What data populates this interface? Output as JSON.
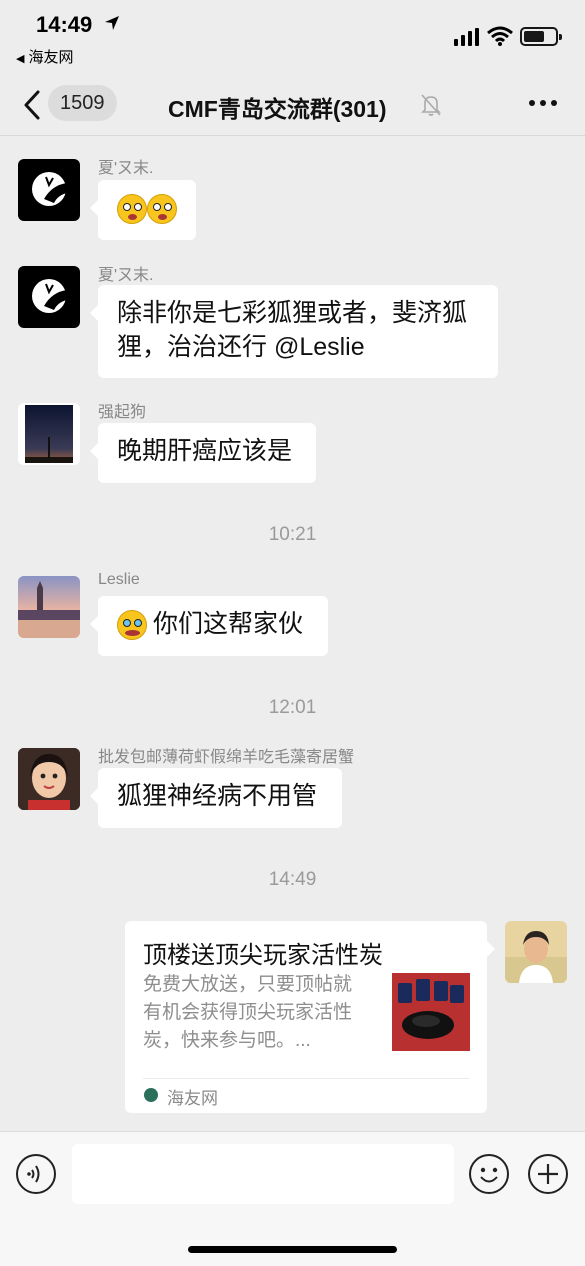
{
  "status_bar": {
    "time": "14:49",
    "back_app_label": "海友网",
    "back_app_glyph": "◀"
  },
  "nav": {
    "unread_count": "1509",
    "title": "CMF青岛交流群(301)"
  },
  "messages": [
    {
      "type": "text",
      "sender": "夏'ㄡ末.",
      "text": ""
    },
    {
      "type": "text",
      "sender": "夏'ㄡ末.",
      "text": "除非你是七彩狐狸或者，斐济狐狸，治治还行 @Leslie"
    },
    {
      "type": "text",
      "sender": "强起狗",
      "text": "晚期肝癌应该是"
    },
    {
      "type": "time",
      "text": "10:21"
    },
    {
      "type": "text",
      "sender": "Leslie",
      "text": "你们这帮家伙"
    },
    {
      "type": "time",
      "text": "12:01"
    },
    {
      "type": "text",
      "sender": "批发包邮薄荷虾假绵羊吃毛藻寄居蟹",
      "text": "狐狸神经病不用管"
    },
    {
      "type": "time",
      "text": "14:49"
    },
    {
      "type": "link_card",
      "card_title": "顶楼送顶尖玩家活性炭",
      "card_desc": "免费大放送，只要顶帖就有机会获得顶尖玩家活性炭，快来参与吧。...",
      "source": "海友网"
    }
  ],
  "icons": {
    "location": "location-arrow-icon",
    "signal": "cellular-signal-icon",
    "wifi": "wifi-icon",
    "battery": "battery-icon",
    "back": "chevron-left-icon",
    "mute": "bell-slash-icon",
    "more": "more-dots-icon",
    "voice": "voice-icon",
    "emoji": "emoji-icon",
    "plus": "plus-icon",
    "source": "haiyou-logo-icon"
  },
  "colors": {
    "background": "#ededed",
    "bubble": "#ffffff",
    "meta_text": "#888888"
  }
}
